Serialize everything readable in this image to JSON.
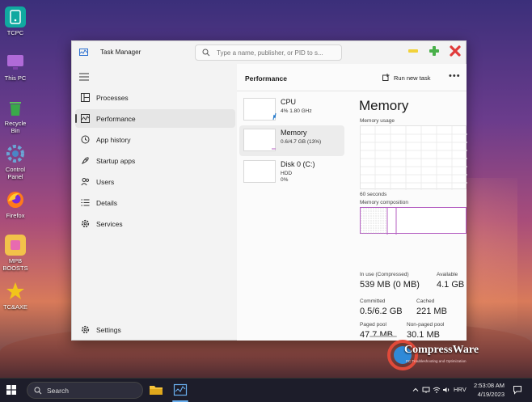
{
  "desktop": {
    "icons": [
      {
        "label": "TCPC"
      },
      {
        "label": "This PC"
      },
      {
        "label": "Recycle Bin"
      },
      {
        "label": "Control Panel"
      },
      {
        "label": "Firefox"
      },
      {
        "label": "MPB BOOSTS"
      },
      {
        "label": "TC&AXE"
      }
    ]
  },
  "window": {
    "title": "Task Manager",
    "search_placeholder": "Type a name, publisher, or PID to s..."
  },
  "sidebar": {
    "items": [
      {
        "label": "Processes",
        "icon": "processes-icon"
      },
      {
        "label": "Performance",
        "icon": "performance-icon",
        "active": true
      },
      {
        "label": "App history",
        "icon": "history-icon"
      },
      {
        "label": "Startup apps",
        "icon": "startup-icon"
      },
      {
        "label": "Users",
        "icon": "users-icon"
      },
      {
        "label": "Details",
        "icon": "details-icon"
      },
      {
        "label": "Services",
        "icon": "services-icon"
      }
    ],
    "settings_label": "Settings"
  },
  "content": {
    "title": "Performance",
    "run_new_task": "Run new task",
    "more": "•••",
    "devices": [
      {
        "name": "CPU",
        "sub1": "4%  1.80 GHz",
        "sub2": ""
      },
      {
        "name": "Memory",
        "sub1": "0.6/4.7 GB (13%)",
        "sub2": "",
        "selected": true
      },
      {
        "name": "Disk 0 (C:)",
        "sub1": "HDD",
        "sub2": "0%"
      }
    ],
    "detail": {
      "heading": "Memory",
      "usage_label": "Memory usage",
      "time_label": "60 seconds",
      "composition_label": "Memory composition",
      "stats": [
        {
          "label": "In use (Compressed)",
          "value": "539 MB (0 MB)"
        },
        {
          "label": "Available",
          "value": "4.1 GB"
        },
        {
          "label": "Committed",
          "value": "0.5/6.2 GB"
        },
        {
          "label": "Cached",
          "value": "221 MB"
        },
        {
          "label": "Paged pool",
          "value": "47.7 MB"
        },
        {
          "label": "Non-paged pool",
          "value": "30.1 MB"
        }
      ]
    }
  },
  "taskbar": {
    "search_label": "Search",
    "language": "HRV",
    "time": "2:53:08 AM",
    "date": "4/19/2023"
  },
  "colors": {
    "memory_accent": "#b45fc2",
    "cpu_accent": "#1a73c8",
    "window_bg": "#f3f3f3"
  }
}
